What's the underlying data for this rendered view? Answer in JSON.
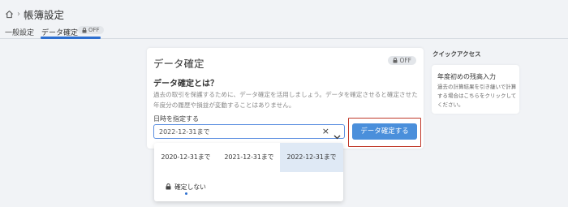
{
  "header": {
    "breadcrumb_sep": "›",
    "title": "帳簿設定"
  },
  "tabs": [
    {
      "label": "一般設定"
    },
    {
      "label": "データ確定",
      "badge": "OFF",
      "active": true
    }
  ],
  "card": {
    "title": "データ確定",
    "badge": "OFF",
    "question": "データ確定とは？",
    "description": "過去の取引を保護するために、データ確定を活用しましょう。データを確定させると確定させた年度分の履歴や損益が変動することはありません。",
    "date_label": "日時を指定する",
    "select_value": "2022-12-31まで",
    "clear_glyph": "×",
    "confirm_button": "データ確定する"
  },
  "dropdown": {
    "options": [
      "2020-12-31まで",
      "2021-12-31まで",
      "2022-12-31まで"
    ],
    "none_option": "確定しない",
    "selected_index": 2
  },
  "quick_access": {
    "title": "クイックアクセス",
    "card_title": "年度初めの残高入力",
    "card_desc": "過去の計算結果を引き継いで計算する場合はこちらをクリックしてください。"
  },
  "colors": {
    "accent": "#2d6fd0",
    "button": "#4a8fdb",
    "highlight_border": "#c0392b",
    "selected_option": "#dfe9f5"
  },
  "icons": {
    "home": "home-icon",
    "lock": "lock-icon",
    "clear": "clear-icon",
    "chevron": "chevron-down-icon"
  }
}
